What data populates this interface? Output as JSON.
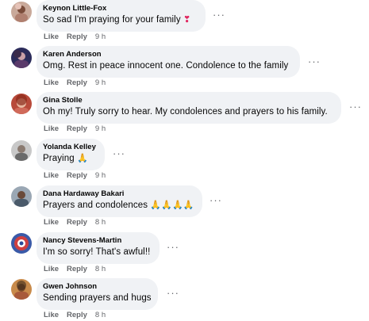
{
  "comments": [
    {
      "author": "Keynon Little-Fox",
      "text": "So sad I'm praying for your family",
      "emoji": "❣",
      "like": "Like",
      "reply": "Reply",
      "time": "9 h",
      "more": "···"
    },
    {
      "author": "Karen Anderson",
      "text": "Omg. Rest in peace innocent one. Condolence to the family",
      "like": "Like",
      "reply": "Reply",
      "time": "9 h",
      "more": "···"
    },
    {
      "author": "Gina Stolle",
      "text": "Oh my! Truly sorry to hear. My condolences and prayers to his family.",
      "like": "Like",
      "reply": "Reply",
      "time": "9 h",
      "more": "···"
    },
    {
      "author": "Yolanda Kelley",
      "text": "Praying",
      "emoji": "🙏",
      "like": "Like",
      "reply": "Reply",
      "time": "9 h",
      "more": "···"
    },
    {
      "author": "Dana Hardaway Bakari",
      "text": "Prayers and condolences",
      "emoji": "🙏🙏",
      "emoji_pale": "🙏🙏",
      "like": "Like",
      "reply": "Reply",
      "time": "8 h",
      "more": "···"
    },
    {
      "author": "Nancy Stevens-Martin",
      "text": "I'm so sorry! That's awful!!",
      "like": "Like",
      "reply": "Reply",
      "time": "8 h",
      "more": "···"
    },
    {
      "author": "Gwen Johnson",
      "text": "Sending prayers and hugs",
      "like": "Like",
      "reply": "Reply",
      "time": "8 h",
      "more": "···"
    }
  ],
  "colors": {
    "bubble": "#f0f2f5",
    "secondary_text": "#65676b",
    "primary_text": "#050505"
  },
  "icons": [
    "avatar",
    "more-options-icon"
  ]
}
